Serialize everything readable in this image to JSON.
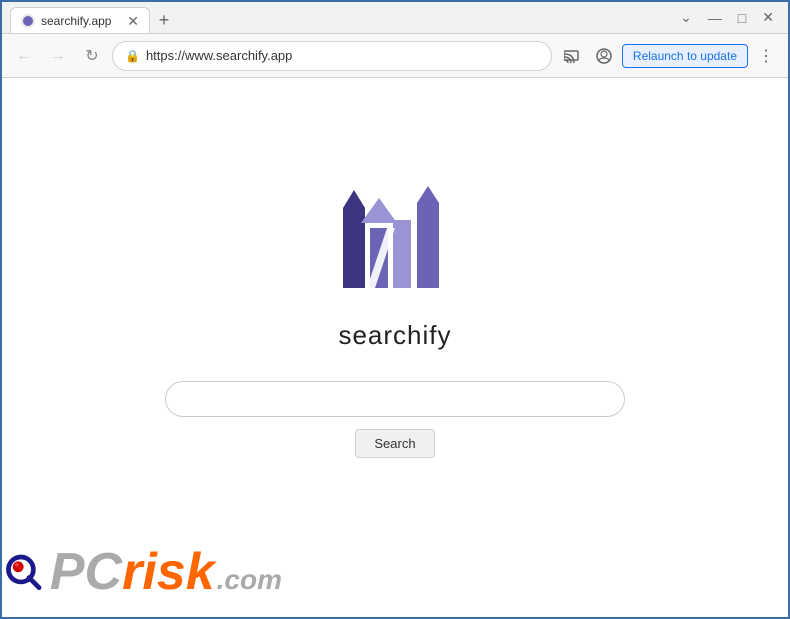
{
  "window": {
    "title": "searchify.app"
  },
  "titlebar": {
    "tab_label": "searchify.app",
    "new_tab_icon": "+",
    "minimize_icon": "—",
    "maximize_icon": "□",
    "close_icon": "✕",
    "chevron_icon": "⌄"
  },
  "navbar": {
    "back_icon": "←",
    "forward_icon": "→",
    "reload_icon": "↻",
    "url": "https://www.searchify.app",
    "lock_icon": "🔒",
    "cast_icon": "▭",
    "profile_icon": "◯",
    "relaunch_label": "Relaunch to update",
    "menu_icon": "⋮"
  },
  "page": {
    "brand_name": "searchify",
    "search_placeholder": "",
    "search_button_label": "Search"
  },
  "colors": {
    "logo_dark": "#3d3580",
    "logo_mid": "#6b63b5",
    "logo_light": "#9b94d4",
    "logo_lighter": "#bfbaee",
    "accent": "#1a73e8",
    "relaunch_bg": "#e8f0fe"
  }
}
